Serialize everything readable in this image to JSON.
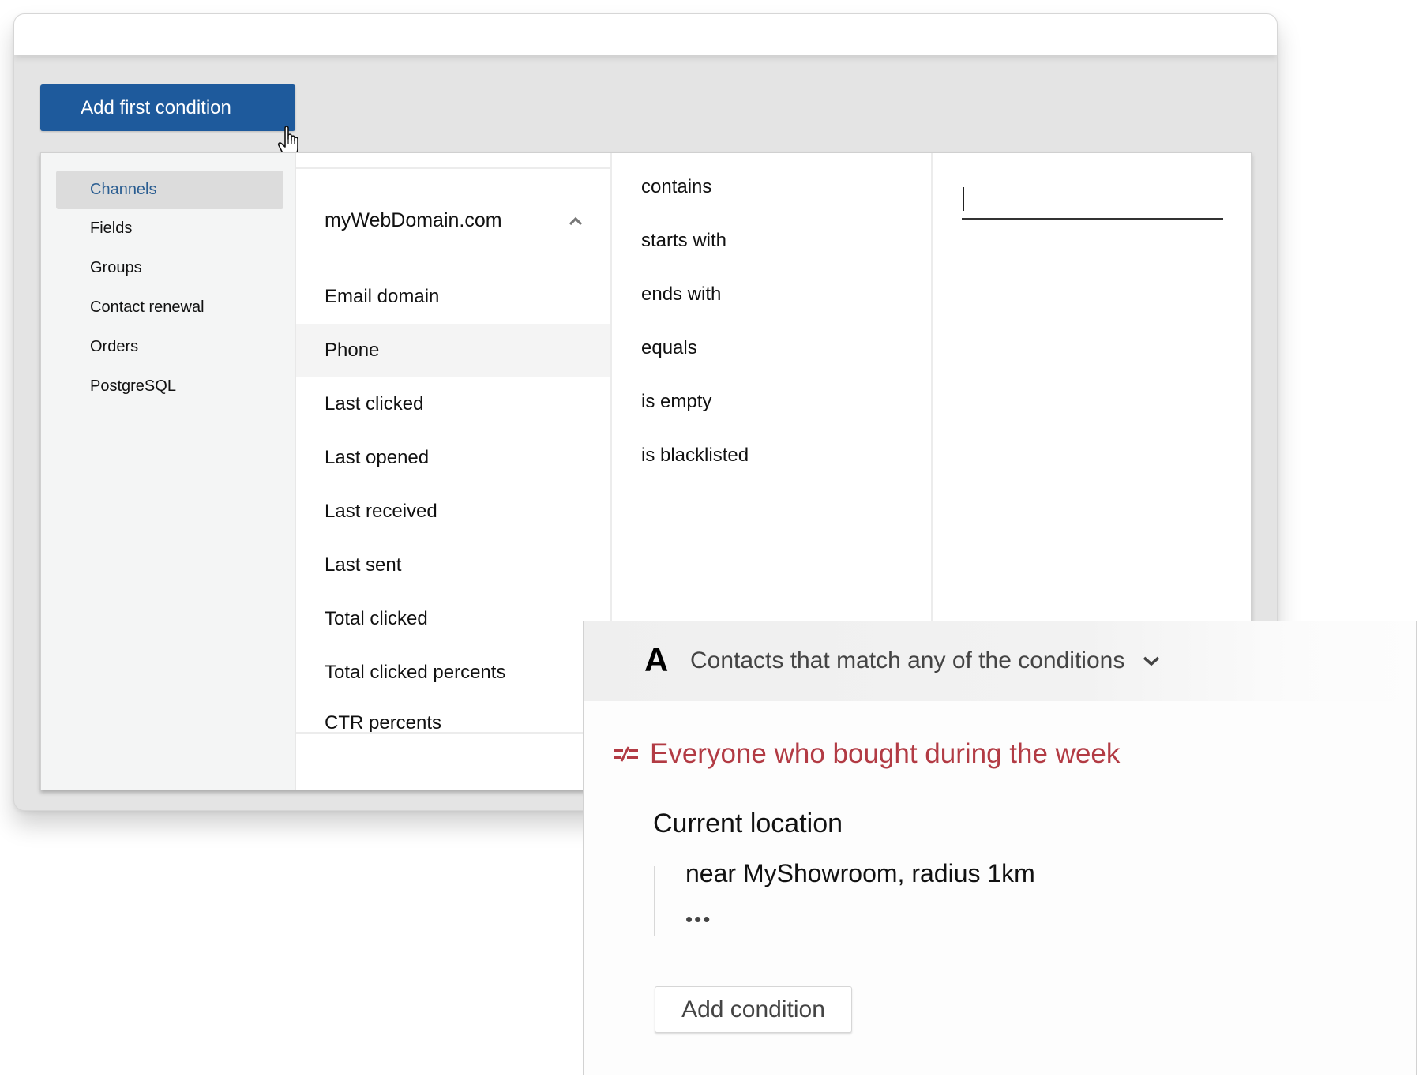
{
  "toolbar": {
    "add_first_condition_label": "Add first condition"
  },
  "sidebar": {
    "items": [
      {
        "label": "Channels",
        "active": true
      },
      {
        "label": "Fields",
        "active": false
      },
      {
        "label": "Groups",
        "active": false
      },
      {
        "label": "Contact renewal",
        "active": false
      },
      {
        "label": "Orders",
        "active": false
      },
      {
        "label": "PostgreSQL",
        "active": false
      }
    ]
  },
  "fields": {
    "group_label": "myWebDomain.com",
    "group_icon": "chevron-up-icon",
    "items": [
      {
        "label": "Email domain"
      },
      {
        "label": "Phone",
        "hovered": true
      },
      {
        "label": "Last clicked"
      },
      {
        "label": "Last opened"
      },
      {
        "label": "Last received"
      },
      {
        "label": "Last sent"
      },
      {
        "label": "Total clicked"
      },
      {
        "label": "Total clicked percents"
      },
      {
        "label": "CTR percents"
      }
    ]
  },
  "operators": {
    "items": [
      {
        "label": "contains"
      },
      {
        "label": "starts with"
      },
      {
        "label": "ends with"
      },
      {
        "label": "equals"
      },
      {
        "label": "is empty"
      },
      {
        "label": "is blacklisted"
      }
    ]
  },
  "value_input": {
    "value": "",
    "placeholder": ""
  },
  "segment_card": {
    "badge": "A",
    "match_mode": "Contacts that match any of the conditions",
    "match_icon": "chevron-down-icon",
    "group_icon": "not-equal-icon",
    "group_title": "Everyone who bought during the week",
    "condition_label": "Current location",
    "condition_value": "near MyShowroom, radius 1km",
    "more_indicator": "•••",
    "add_condition_label": "Add condition"
  },
  "colors": {
    "primary": "#1e5a9c",
    "active_text": "#2a5d91",
    "group_title": "#b23b44"
  }
}
